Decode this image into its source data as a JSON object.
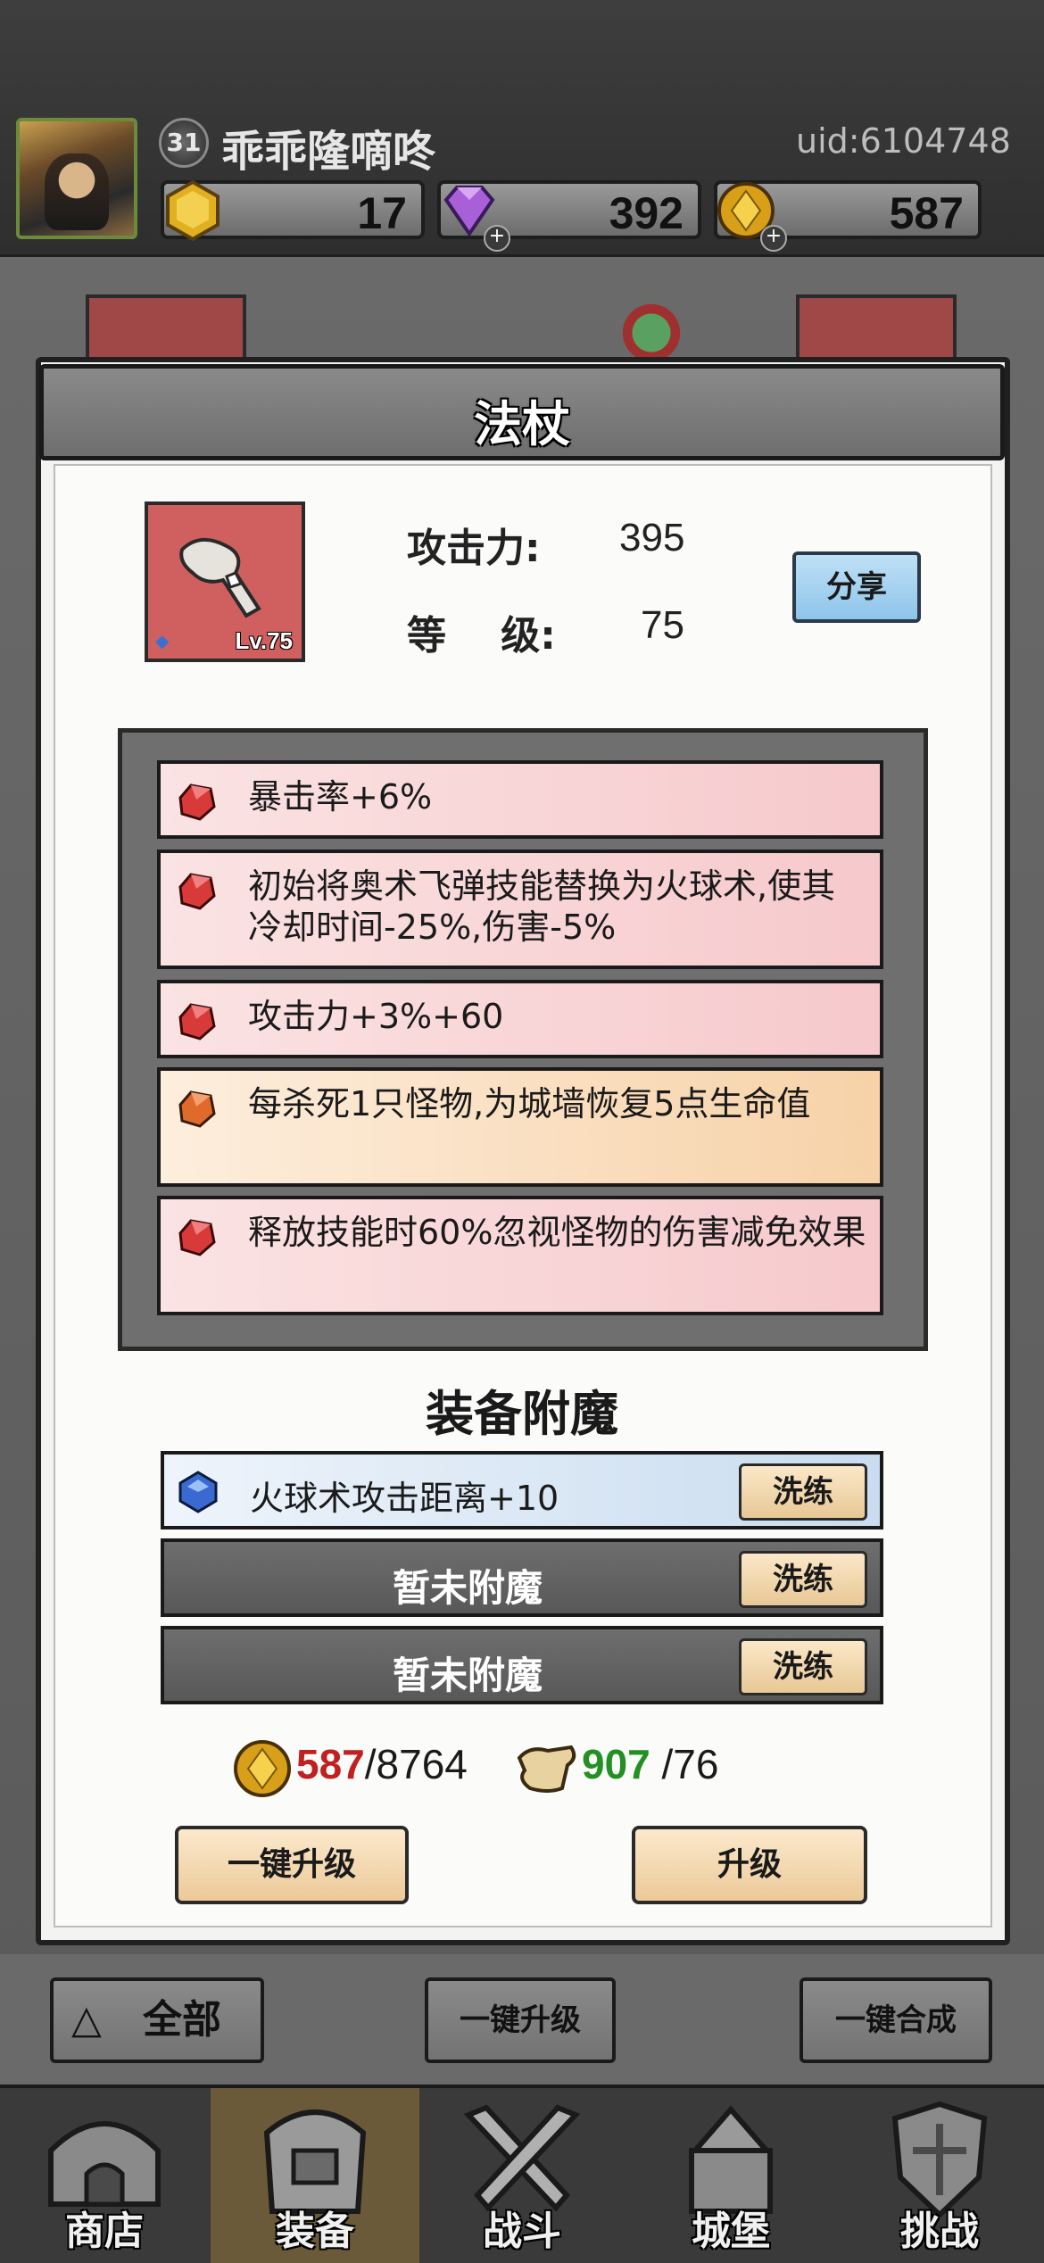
{
  "header": {
    "player_level": "31",
    "player_name": "乖乖隆嘀咚",
    "uid": "uid:6104748",
    "resources": [
      {
        "icon": "gold-hexagon-icon",
        "value": "17"
      },
      {
        "icon": "purple-diamond-icon",
        "value": "392"
      },
      {
        "icon": "gold-coin-icon",
        "value": "587"
      }
    ]
  },
  "modal": {
    "title": "法杖",
    "item": {
      "level_label": "Lv.75",
      "icon": "staff-icon"
    },
    "attack_label": "攻击力:",
    "attack_value": "395",
    "level_label": "等    级:",
    "level_value": "75",
    "share_label": "分享",
    "affixes": [
      {
        "text": "暴击率+6%",
        "color": "red"
      },
      {
        "text": "初始将奥术飞弹技能替换为火球术,使其冷却时间-25%,伤害-5%",
        "color": "red"
      },
      {
        "text": "攻击力+3%+60",
        "color": "red"
      },
      {
        "text": "每杀死1只怪物,为城墙恢复5点生命值",
        "color": "orange"
      },
      {
        "text": "释放技能时60%忽视怪物的伤害减免效果",
        "color": "red"
      }
    ],
    "enchant_title": "装备附魔",
    "enchants": [
      {
        "text": "火球术攻击距离+10",
        "wash_label": "洗练"
      },
      {
        "text": "暂未附魔",
        "wash_label": "洗练"
      },
      {
        "text": "暂未附魔",
        "wash_label": "洗练"
      }
    ],
    "cost_gold_have": "587",
    "cost_gold_need": "/8764",
    "cost_scroll_have": "907",
    "cost_scroll_need": "/76",
    "one_click_upgrade": "一键升级",
    "upgrade": "升级"
  },
  "actions": {
    "filter_label": "全部",
    "one_click_upgrade": "一键升级",
    "one_click_merge": "一键合成"
  },
  "nav": [
    {
      "label": "商店",
      "icon": "shop-icon"
    },
    {
      "label": "装备",
      "icon": "equipment-bag-icon",
      "active": true
    },
    {
      "label": "战斗",
      "icon": "crossed-swords-icon"
    },
    {
      "label": "城堡",
      "icon": "castle-icon"
    },
    {
      "label": "挑战",
      "icon": "challenge-shield-icon"
    }
  ],
  "colors": {
    "affix_red": "#f6c9cc",
    "affix_orange": "#f7d2a8",
    "cost_red": "#c02020",
    "cost_green": "#229022"
  }
}
